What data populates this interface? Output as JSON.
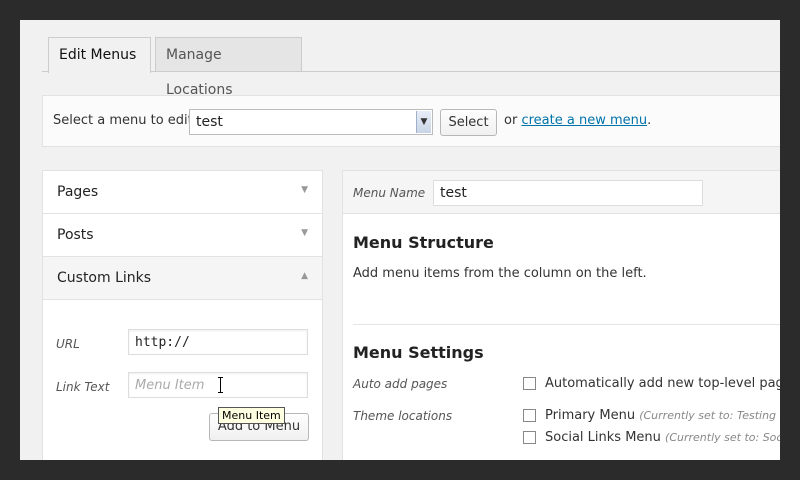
{
  "tabs": [
    {
      "label": "Edit Menus",
      "active": true
    },
    {
      "label": "Manage Locations",
      "active": false
    }
  ],
  "menu_select_bar": {
    "label": "Select a menu to edit:",
    "selected_menu": "test",
    "select_button": "Select",
    "or_text": "or",
    "create_link": "create a new menu",
    "period": "."
  },
  "accordion": {
    "sections": [
      {
        "title": "Pages",
        "open": false
      },
      {
        "title": "Posts",
        "open": false
      },
      {
        "title": "Custom Links",
        "open": true
      }
    ],
    "custom_links": {
      "url_label": "URL",
      "url_value": "http://",
      "link_text_label": "Link Text",
      "link_text_placeholder": "Menu Item",
      "add_button": "Add to Menu",
      "tooltip": "Menu Item"
    }
  },
  "menu_editor": {
    "name_label": "Menu Name",
    "name_value": "test",
    "structure_heading": "Menu Structure",
    "structure_hint": "Add menu items from the column on the left.",
    "settings_heading": "Menu Settings",
    "auto_add_label": "Auto add pages",
    "auto_add_text": "Automatically add new top-level pages to",
    "theme_locations_label": "Theme locations",
    "locations": [
      {
        "name": "Primary Menu",
        "note": "(Currently set to: Testing Me"
      },
      {
        "name": "Social Links Menu",
        "note": "(Currently set to: Social M"
      }
    ]
  },
  "colors": {
    "link": "#0073aa",
    "background": "#f1f1f1",
    "frame": "#2b2b2b"
  }
}
